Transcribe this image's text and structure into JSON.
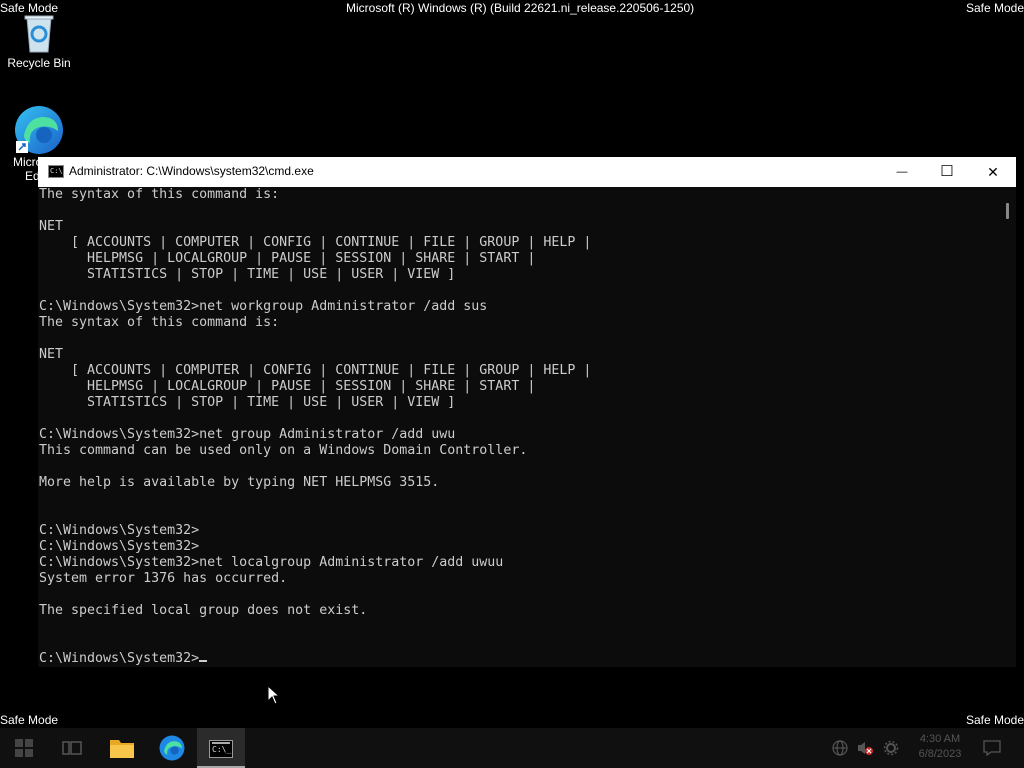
{
  "desktop": {
    "safe_mode_text": "Safe Mode",
    "build_text": "Microsoft (R) Windows (R) (Build 22621.ni_release.220506-1250)",
    "recycle_bin_label": "Recycle Bin",
    "edge_label_1": "Micro",
    "edge_label_2": "Ed"
  },
  "window": {
    "title": "Administrator: C:\\Windows\\system32\\cmd.exe",
    "minimize_glyph": "—",
    "maximize_glyph": "☐",
    "close_glyph": "✕",
    "icon_text": "C:\\_"
  },
  "console": {
    "lines": [
      "The syntax of this command is:",
      "",
      "NET",
      "    [ ACCOUNTS | COMPUTER | CONFIG | CONTINUE | FILE | GROUP | HELP |",
      "      HELPMSG | LOCALGROUP | PAUSE | SESSION | SHARE | START |",
      "      STATISTICS | STOP | TIME | USE | USER | VIEW ]",
      "",
      "C:\\Windows\\System32>net workgroup Administrator /add sus",
      "The syntax of this command is:",
      "",
      "NET",
      "    [ ACCOUNTS | COMPUTER | CONFIG | CONTINUE | FILE | GROUP | HELP |",
      "      HELPMSG | LOCALGROUP | PAUSE | SESSION | SHARE | START |",
      "      STATISTICS | STOP | TIME | USE | USER | VIEW ]",
      "",
      "C:\\Windows\\System32>net group Administrator /add uwu",
      "This command can be used only on a Windows Domain Controller.",
      "",
      "More help is available by typing NET HELPMSG 3515.",
      "",
      "",
      "C:\\Windows\\System32>",
      "C:\\Windows\\System32>",
      "C:\\Windows\\System32>net localgroup Administrator /add uwuu",
      "System error 1376 has occurred.",
      "",
      "The specified local group does not exist.",
      "",
      ""
    ],
    "prompt": "C:\\Windows\\System32>"
  },
  "taskbar": {
    "time": "4:30 AM",
    "date": "6/8/2023"
  },
  "colors": {
    "console_bg": "#0c0c0c",
    "console_text": "#cccccc",
    "taskbar_bg": "#101010"
  }
}
